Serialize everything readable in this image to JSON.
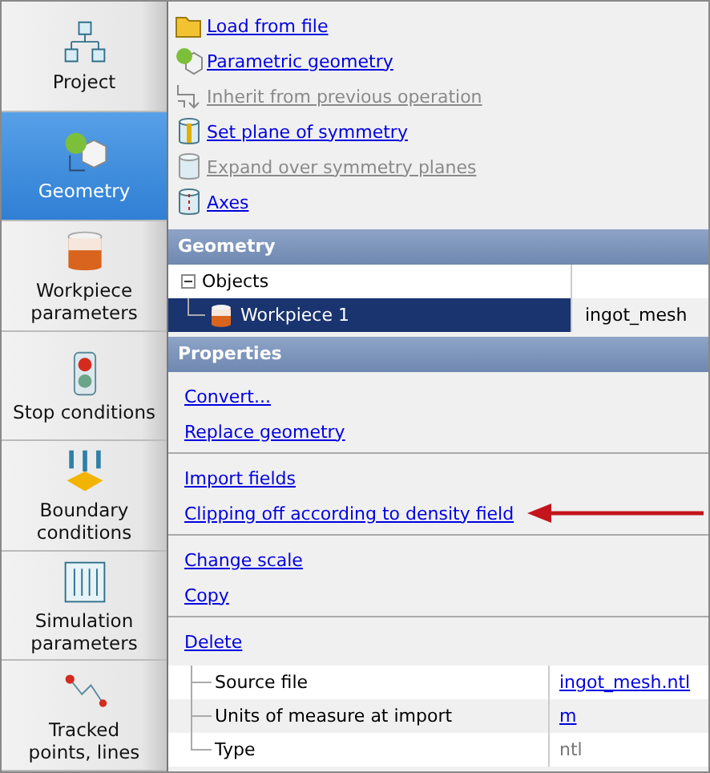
{
  "sidebar": {
    "items": [
      {
        "label": "Project",
        "selected": false
      },
      {
        "label": "Geometry",
        "selected": true
      },
      {
        "label": "Workpiece\nparameters",
        "selected": false
      },
      {
        "label": "Stop conditions",
        "selected": false
      },
      {
        "label": "Boundary\nconditions",
        "selected": false
      },
      {
        "label": "Simulation\nparameters",
        "selected": false
      },
      {
        "label": "Tracked\npoints, lines",
        "selected": false
      }
    ]
  },
  "actions": [
    {
      "label": "Load from file",
      "disabled": false
    },
    {
      "label": "Parametric geometry",
      "disabled": false
    },
    {
      "label": "Inherit from previous operation",
      "disabled": true
    },
    {
      "label": "Set plane of symmetry",
      "disabled": false
    },
    {
      "label": "Expand over symmetry planes",
      "disabled": true
    },
    {
      "label": "Axes",
      "disabled": false
    }
  ],
  "geometry": {
    "title": "Geometry",
    "tree": [
      {
        "label": "Objects",
        "expanded": true,
        "children": [
          {
            "label": "Workpiece 1",
            "value": "ingot_mesh",
            "selected": true
          }
        ]
      }
    ]
  },
  "properties": {
    "title": "Properties",
    "groups": [
      [
        {
          "label": "Convert...",
          "highlighted": false
        },
        {
          "label": "Replace geometry",
          "highlighted": false
        }
      ],
      [
        {
          "label": "Import fields",
          "highlighted": false
        },
        {
          "label": "Clipping off according to density field",
          "highlighted": true
        }
      ],
      [
        {
          "label": "Change scale",
          "highlighted": false
        },
        {
          "label": "Copy",
          "highlighted": false
        }
      ],
      [
        {
          "label": "Delete",
          "highlighted": false
        }
      ]
    ],
    "rows": [
      {
        "name": "Source file",
        "value": "ingot_mesh.ntl",
        "kind": "link"
      },
      {
        "name": "Units of measure at import",
        "value": "m",
        "kind": "link"
      },
      {
        "name": "Type",
        "value": "ntl",
        "kind": "text"
      }
    ]
  }
}
